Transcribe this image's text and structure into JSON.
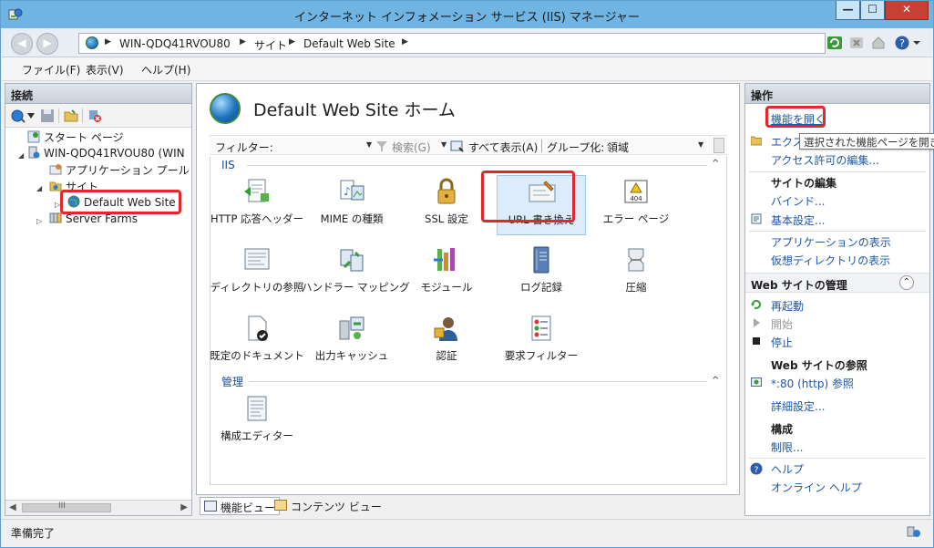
{
  "window": {
    "title": "インターネット インフォメーション サービス (IIS) マネージャー",
    "min_glyph": "—",
    "max_glyph": "☐",
    "close_glyph": "✕"
  },
  "address": {
    "back": "◀",
    "forward": "▶",
    "crumbs": [
      "WIN-QDQ41RVOU80",
      "サイト",
      "Default Web Site"
    ],
    "sep": "▶"
  },
  "menu": [
    "ファイル(F)",
    "表示(V)",
    "ヘルプ(H)"
  ],
  "connections": {
    "header": "接続",
    "tree": [
      "スタート ページ",
      "WIN-QDQ41RVOU80 (WIN",
      "アプリケーション プール",
      "サイト",
      "Default Web Site",
      "Server Farms"
    ],
    "scroll_mark": "III"
  },
  "center": {
    "title": "Default Web Site ホーム",
    "filter_label": "フィルター:",
    "search": "検索(G)",
    "show_all": "すべて表示(A)",
    "group_by_label": "グループ化:",
    "group_by_value": "領域",
    "groups": [
      {
        "label": "IIS",
        "features": [
          "HTTP 応答ヘッダー",
          "MIME の種類",
          "SSL 設定",
          "URL 書き換え",
          "エラー ページ",
          "ディレクトリの参照",
          "ハンドラー マッピング",
          "モジュール",
          "ログ記録",
          "圧縮",
          "既定のドキュメント",
          "出力キャッシュ",
          "認証",
          "要求フィルター"
        ]
      },
      {
        "label": "管理",
        "features": [
          "構成エディター"
        ]
      }
    ],
    "collapse_glyph": "^"
  },
  "views": {
    "feature_view": "機能ビュー",
    "content_view": "コンテンツ ビュー"
  },
  "actions": {
    "header": "操作",
    "open_feature": "機能を開く",
    "explore": "エクスプ",
    "edit_permissions": "アクセス許可の編集...",
    "edit_site_head": "サイトの編集",
    "bindings": "バインド...",
    "basic_settings": "基本設定...",
    "view_applications": "アプリケーションの表示",
    "view_virtual_dirs": "仮想ディレクトリの表示",
    "manage_site_head": "Web サイトの管理",
    "restart": "再起動",
    "start": "開始",
    "stop": "停止",
    "browse_head": "Web サイトの参照",
    "browse_80": "*:80 (http) 参照",
    "advanced_settings": "詳細設定...",
    "config_head": "構成",
    "limits": "制限...",
    "help": "ヘルプ",
    "online_help": "オンライン ヘルプ",
    "collapse_glyph": "⌃"
  },
  "tooltip": "選択された機能ページを開きます",
  "status": {
    "text": "準備完了"
  },
  "colors": {
    "title_bar": "#6fb4e2",
    "highlight_red": "#e0282e",
    "link_blue": "#1e56a8"
  }
}
